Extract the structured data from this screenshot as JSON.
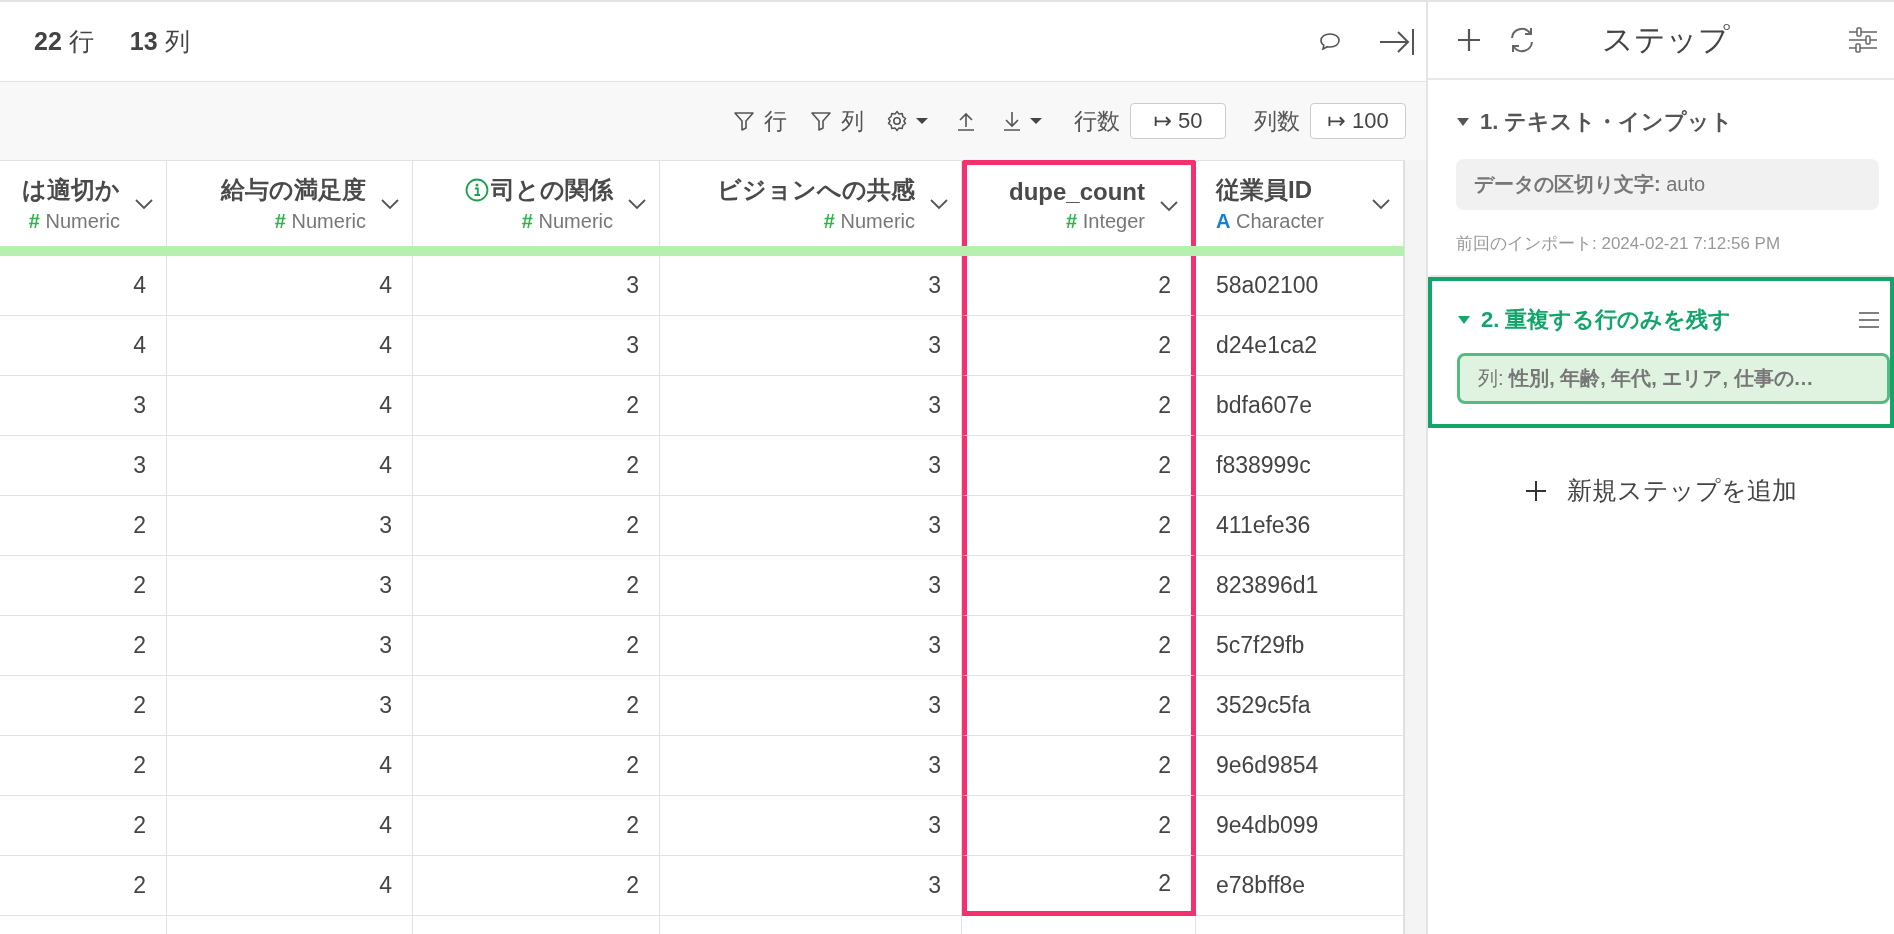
{
  "summary": {
    "rows": "**22** 行",
    "cols": "**13** 列"
  },
  "toolbar": {
    "filters": [
      {
        "label": "行"
      },
      {
        "label": "列"
      }
    ],
    "row_count": {
      "label": "行数",
      "value": "↦ 50"
    },
    "col_count": {
      "label": "列数",
      "value": "↦ 100"
    }
  },
  "columns": [
    {
      "name": "は適切か",
      "kind": "numeric",
      "type_icon": "#",
      "type": "Numeric",
      "info": false,
      "highlighted": false
    },
    {
      "name": "給与の満足度",
      "kind": "numeric",
      "type_icon": "#",
      "type": "Numeric",
      "info": false,
      "highlighted": false
    },
    {
      "name": "司との関係",
      "kind": "numeric",
      "type_icon": "#",
      "type": "Numeric",
      "info": true,
      "highlighted": false
    },
    {
      "name": "ビジョンへの共感",
      "kind": "numeric",
      "type_icon": "#",
      "type": "Numeric",
      "info": false,
      "highlighted": false
    },
    {
      "name": "dupe_count",
      "kind": "numeric",
      "type_icon": "#",
      "type": "Integer",
      "info": false,
      "highlighted": true
    },
    {
      "name": "従業員ID",
      "kind": "character",
      "type_icon": "A",
      "type": "Character",
      "info": false,
      "highlighted": false
    }
  ],
  "rows": [
    [
      "4",
      "4",
      "3",
      "3",
      "2",
      "58a02100"
    ],
    [
      "4",
      "4",
      "3",
      "3",
      "2",
      "d24e1ca2"
    ],
    [
      "3",
      "4",
      "2",
      "3",
      "2",
      "bdfa607e"
    ],
    [
      "3",
      "4",
      "2",
      "3",
      "2",
      "f838999c"
    ],
    [
      "2",
      "3",
      "2",
      "3",
      "2",
      "411efe36"
    ],
    [
      "2",
      "3",
      "2",
      "3",
      "2",
      "823896d1"
    ],
    [
      "2",
      "3",
      "2",
      "3",
      "2",
      "5c7f29fb"
    ],
    [
      "2",
      "3",
      "2",
      "3",
      "2",
      "3529c5fa"
    ],
    [
      "2",
      "4",
      "2",
      "3",
      "2",
      "9e6d9854"
    ],
    [
      "2",
      "4",
      "2",
      "3",
      "2",
      "9e4db099"
    ],
    [
      "2",
      "4",
      "2",
      "3",
      "2",
      "e78bff8e"
    ]
  ],
  "steps_panel": {
    "title": "ステップ",
    "add_label": "新規ステップを追加",
    "steps": [
      {
        "title": "1. テキスト・インプット",
        "expanded": true,
        "selected": false,
        "param": "**データの区切り文字:** auto",
        "note": "前回のインポート: 2024-02-21 7:12:56 PM"
      },
      {
        "title": "2. 重複する行のみを残す",
        "expanded": true,
        "selected": true,
        "param": "列: **性別, 年齢, 年代, エリア, 仕事の…**"
      }
    ]
  }
}
